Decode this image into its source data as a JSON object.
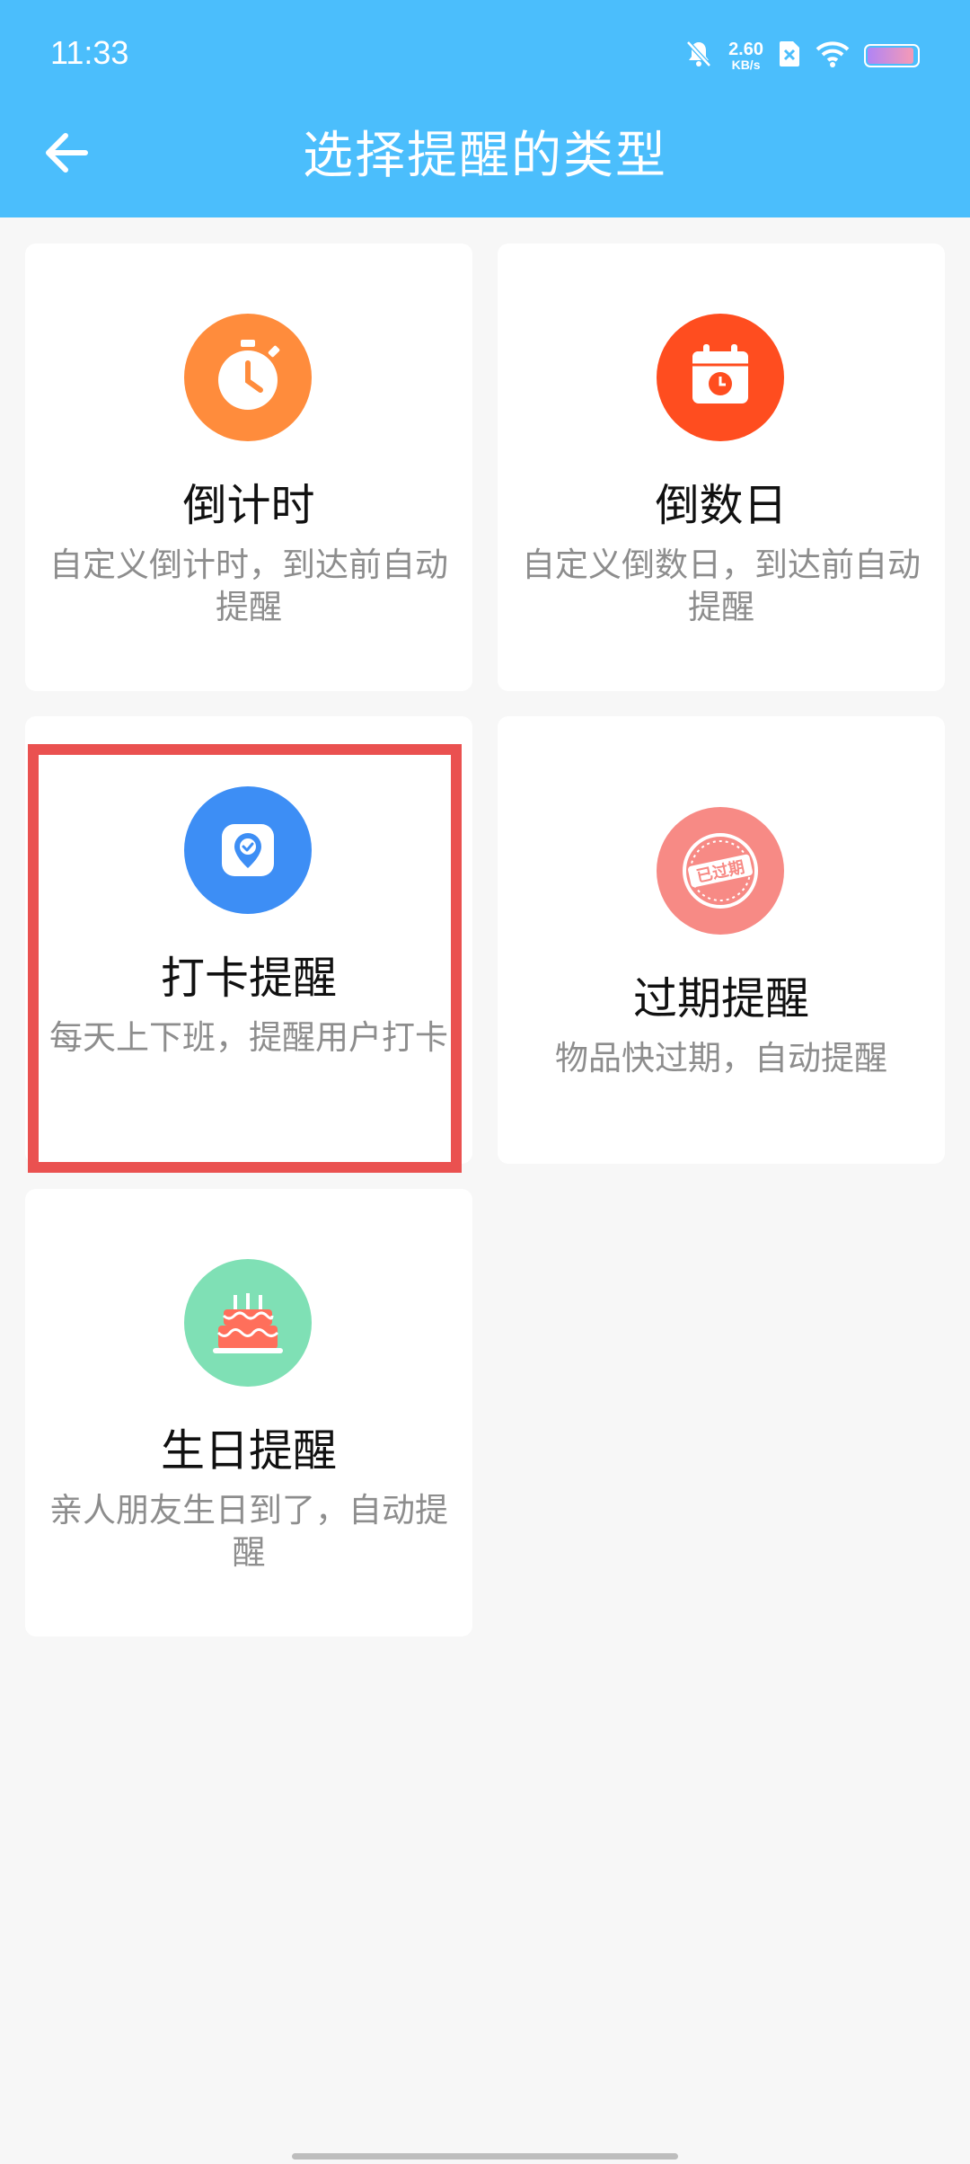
{
  "status_bar": {
    "time": "11:33",
    "net_speed_value": "2.60",
    "net_speed_unit": "KB/s",
    "battery_level": 0.95
  },
  "header": {
    "title": "选择提醒的类型"
  },
  "cards": [
    {
      "title": "倒计时",
      "desc": "自定义倒计时，到达前自动提醒",
      "icon": "stopwatch-icon",
      "color": "#ff8c3c"
    },
    {
      "title": "倒数日",
      "desc": "自定义倒数日，到达前自动提醒",
      "icon": "calendar-icon",
      "color": "#ff4d1f"
    },
    {
      "title": "打卡提醒",
      "desc": "每天上下班，提醒用户打卡",
      "icon": "location-check-icon",
      "color": "#3d8ef5"
    },
    {
      "title": "过期提醒",
      "desc": "物品快过期，自动提醒",
      "icon": "expired-stamp-icon",
      "stamp_text": "已过期",
      "color": "#f78a85"
    },
    {
      "title": "生日提醒",
      "desc": "亲人朋友生日到了，自动提醒",
      "icon": "birthday-cake-icon",
      "color": "#7fe0b5"
    }
  ],
  "colors": {
    "header_bg": "#4bbefc",
    "page_bg": "#f7f7f7",
    "highlight": "#ea5150"
  }
}
